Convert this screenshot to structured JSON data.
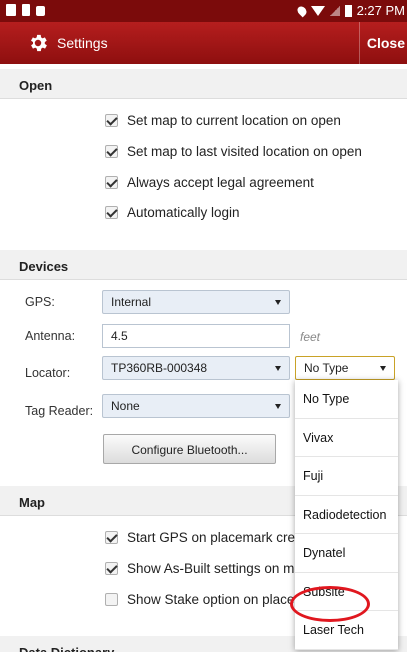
{
  "status_bar": {
    "time": "2:27 PM"
  },
  "app_bar": {
    "title": "Settings",
    "close_label": "Close"
  },
  "sections": {
    "open": "Open",
    "devices": "Devices",
    "map": "Map",
    "data_dictionary": "Data Dictionary"
  },
  "open_options": [
    {
      "label": "Set map to current location on open",
      "checked": true
    },
    {
      "label": "Set map to last visited location on open",
      "checked": true
    },
    {
      "label": "Always accept legal agreement",
      "checked": true
    },
    {
      "label": "Automatically login",
      "checked": true
    }
  ],
  "devices": {
    "gps_label": "GPS:",
    "gps_value": "Internal",
    "antenna_label": "Antenna:",
    "antenna_value": "4.5",
    "antenna_unit": "feet",
    "locator_label": "Locator:",
    "locator_value": "TP360RB-000348",
    "locator_type_value": "No Type",
    "tag_reader_label": "Tag Reader:",
    "tag_reader_value": "None",
    "bluetooth_button": "Configure Bluetooth..."
  },
  "map_options": [
    {
      "label": "Start GPS on placemark creation",
      "checked": true
    },
    {
      "label": "Show As-Built settings on move",
      "checked": true
    },
    {
      "label": "Show Stake option on placemark",
      "checked": false
    }
  ],
  "locator_type_options": [
    "No Type",
    "Vivax",
    "Fuji",
    "Radiodetection",
    "Dynatel",
    "Subsite",
    "Laser Tech"
  ],
  "colors": {
    "app_bar": "#a01414",
    "status_bar": "#7b0b0b",
    "highlight": "#e0171f"
  }
}
